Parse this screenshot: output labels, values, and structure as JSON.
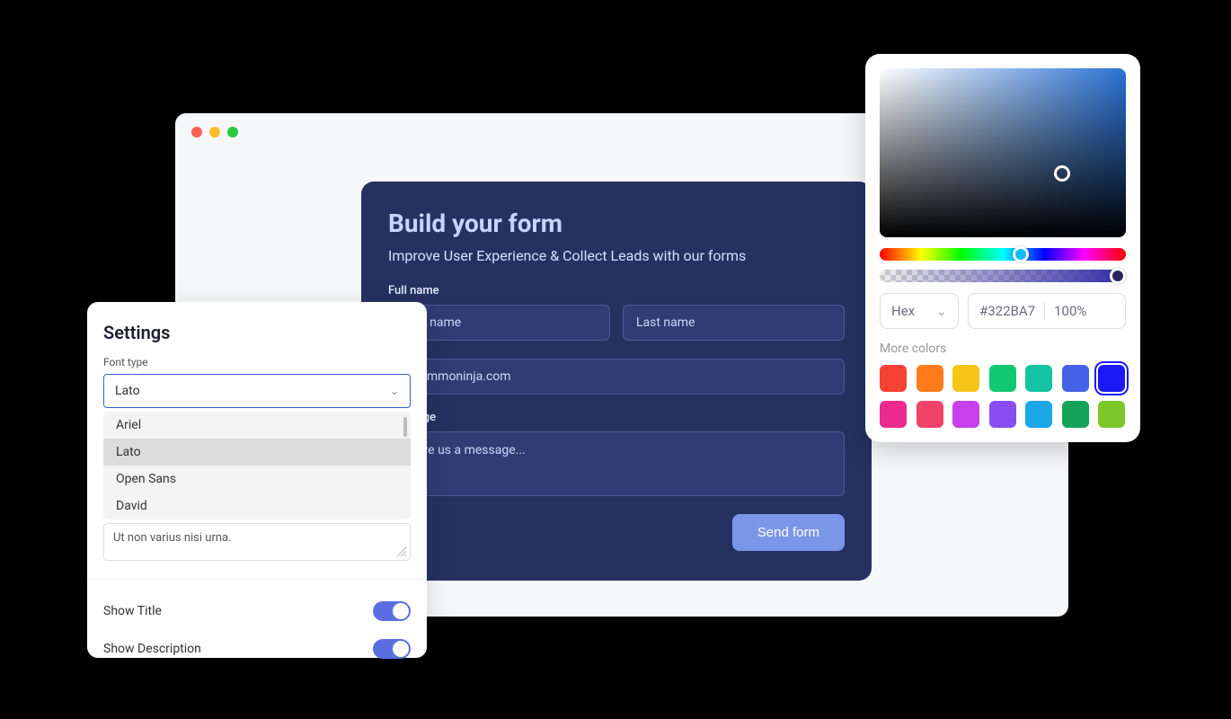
{
  "form": {
    "title": "Build your form",
    "subtitle": "Improve User Experience & Collect Leads with our forms",
    "fullname_label": "Full name",
    "firstname_placeholder": "First name",
    "lastname_placeholder": "Last name",
    "email_value": "@commoninja.com",
    "message_label": "Message",
    "message_placeholder": "Leave us a message...",
    "send_label": "Send form"
  },
  "settings": {
    "title": "Settings",
    "font_label": "Font type",
    "selected_font": "Lato",
    "font_options": [
      "Ariel",
      "Lato",
      "Open Sans",
      "David"
    ],
    "description_value": "Ut non varius nisi urna.",
    "show_title_label": "Show Title",
    "show_title_value": true,
    "show_description_label": "Show Description",
    "show_description_value": true
  },
  "colorpicker": {
    "format_label": "Hex",
    "hex_value": "#322BA7",
    "alpha_value": "100%",
    "more_colors_label": "More colors",
    "swatches": [
      {
        "color": "#f44336",
        "selected": false
      },
      {
        "color": "#ff7b1c",
        "selected": false
      },
      {
        "color": "#f5c518",
        "selected": false
      },
      {
        "color": "#10c971",
        "selected": false
      },
      {
        "color": "#14c3a2",
        "selected": false
      },
      {
        "color": "#4462e6",
        "selected": false
      },
      {
        "color": "#1a1af5",
        "selected": true
      },
      {
        "color": "#ec2a8f",
        "selected": false
      },
      {
        "color": "#f04369",
        "selected": false
      },
      {
        "color": "#c940e8",
        "selected": false
      },
      {
        "color": "#8a4cf0",
        "selected": false
      },
      {
        "color": "#1aa8e8",
        "selected": false
      },
      {
        "color": "#15a35a",
        "selected": false
      },
      {
        "color": "#7cc729",
        "selected": false
      }
    ]
  }
}
